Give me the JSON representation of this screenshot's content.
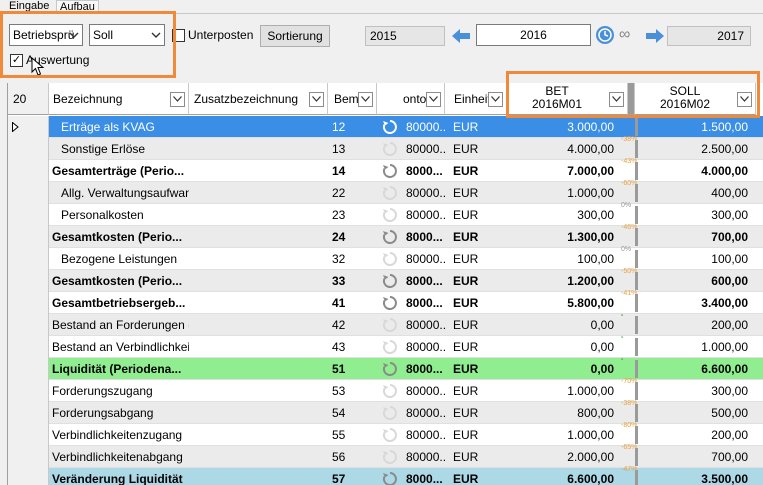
{
  "tabs": [
    "Eingabe",
    "Aufbau"
  ],
  "toolbar": {
    "combo1": "Betriebsprü",
    "combo2": "Soll",
    "unterposten_label": "Unterposten",
    "unterposten_checked": false,
    "sortierung_label": "Sortierung",
    "auswertung_label": "Auswertung",
    "auswertung_checked": true,
    "year_from": "2015",
    "year_current": "2016",
    "year_to": "2017",
    "infinity": "∞"
  },
  "grid": {
    "corner": "20",
    "columns": {
      "bezeichnung": "Bezeichnung",
      "zusatz": "Zusatzbezeichnung",
      "bem": "Bem",
      "konto": "onto",
      "einheit": "Einheit",
      "bet_line1": "BET",
      "bet_line2": "2016M01",
      "soll_line1": "SOLL",
      "soll_line2": "2016M02"
    },
    "rows": [
      {
        "label": "Erträge als KVAG",
        "indent": true,
        "bold": false,
        "nr": "12",
        "konto": "80000...",
        "einheit": "EUR",
        "bet": "3.000,00",
        "pct": "",
        "soll": "1.500,00",
        "bg": "#3a8ee6",
        "selected": true,
        "marker": true
      },
      {
        "label": "Sonstige Erlöse",
        "indent": true,
        "bold": false,
        "nr": "13",
        "konto": "80000...",
        "einheit": "EUR",
        "bet": "4.000,00",
        "pct": "-38%",
        "soll": "2.500,00",
        "bg": "#ebebeb"
      },
      {
        "label": "Gesamterträge (Perio...",
        "indent": false,
        "bold": true,
        "nr": "14",
        "konto": "8000...",
        "einheit": "EUR",
        "bet": "7.000,00",
        "pct": "-43%",
        "soll": "4.000,00",
        "bg": "#ffffff"
      },
      {
        "label": "Allg. Verwaltungsaufwand",
        "indent": true,
        "bold": false,
        "nr": "22",
        "konto": "80000...",
        "einheit": "EUR",
        "bet": "1.000,00",
        "pct": "-60%",
        "soll": "400,00",
        "bg": "#ebebeb"
      },
      {
        "label": "Personalkosten",
        "indent": true,
        "bold": false,
        "nr": "23",
        "konto": "80000...",
        "einheit": "EUR",
        "bet": "300,00",
        "pct": "0%",
        "soll": "300,00",
        "bg": "#ffffff"
      },
      {
        "label": "Gesamtkosten (Perio...",
        "indent": false,
        "bold": true,
        "nr": "24",
        "konto": "8000...",
        "einheit": "EUR",
        "bet": "1.300,00",
        "pct": "-46%",
        "soll": "700,00",
        "bg": "#ebebeb"
      },
      {
        "label": "Bezogene Leistungen",
        "indent": true,
        "bold": false,
        "nr": "32",
        "konto": "80000...",
        "einheit": "EUR",
        "bet": "100,00",
        "pct": "0%",
        "soll": "100,00",
        "bg": "#ffffff"
      },
      {
        "label": "Gesamtkosten (Perio...",
        "indent": false,
        "bold": true,
        "nr": "33",
        "konto": "8000...",
        "einheit": "EUR",
        "bet": "1.200,00",
        "pct": "-50%",
        "soll": "600,00",
        "bg": "#ebebeb"
      },
      {
        "label": "Gesamtbetriebsergeb...",
        "indent": false,
        "bold": true,
        "nr": "41",
        "konto": "8000...",
        "einheit": "EUR",
        "bet": "5.800,00",
        "pct": "-41%",
        "soll": "3.400,00",
        "bg": "#ffffff"
      },
      {
        "label": "Bestand an Forderungen (...",
        "indent": false,
        "bold": false,
        "nr": "42",
        "konto": "80000...",
        "einheit": "EUR",
        "bet": "0,00",
        "pct": "-",
        "soll": "200,00",
        "bg": "#ebebeb"
      },
      {
        "label": "Bestand an Verbindlichkei...",
        "indent": false,
        "bold": false,
        "nr": "43",
        "konto": "80000...",
        "einheit": "EUR",
        "bet": "0,00",
        "pct": "-",
        "soll": "1.000,00",
        "bg": "#ffffff"
      },
      {
        "label": "Liquidität (Periodena...",
        "indent": false,
        "bold": true,
        "nr": "51",
        "konto": "8000...",
        "einheit": "EUR",
        "bet": "0,00",
        "pct": "-",
        "soll": "6.600,00",
        "bg": "#90ee90"
      },
      {
        "label": "Forderungszugang",
        "indent": false,
        "bold": false,
        "nr": "53",
        "konto": "80000...",
        "einheit": "EUR",
        "bet": "1.000,00",
        "pct": "-70%",
        "soll": "300,00",
        "bg": "#ffffff"
      },
      {
        "label": "Forderungsabgang",
        "indent": false,
        "bold": false,
        "nr": "54",
        "konto": "80000...",
        "einheit": "EUR",
        "bet": "800,00",
        "pct": "-38%",
        "soll": "500,00",
        "bg": "#ebebeb"
      },
      {
        "label": "Verbindlichkeitenzugang",
        "indent": false,
        "bold": false,
        "nr": "55",
        "konto": "80000...",
        "einheit": "EUR",
        "bet": "1.000,00",
        "pct": "-80%",
        "soll": "200,00",
        "bg": "#ffffff"
      },
      {
        "label": "Verbindlichkeitenabgang",
        "indent": false,
        "bold": false,
        "nr": "56",
        "konto": "80000...",
        "einheit": "EUR",
        "bet": "2.000,00",
        "pct": "-65%",
        "soll": "700,00",
        "bg": "#ebebeb"
      },
      {
        "label": "Veränderung Liquidität",
        "indent": false,
        "bold": true,
        "nr": "57",
        "konto": "8000...",
        "einheit": "EUR",
        "bet": "6.600,00",
        "pct": "-47%",
        "soll": "3.500,00",
        "bg": "#add8e6"
      }
    ]
  },
  "colors": {
    "highlight": "#f08a38",
    "selected_row": "#3a8ee6",
    "liquiditaet_row": "#90ee90",
    "veraenderung_row": "#add8e6",
    "pct_negative": "#e8a040",
    "arrow_blue": "#4a90d9"
  }
}
